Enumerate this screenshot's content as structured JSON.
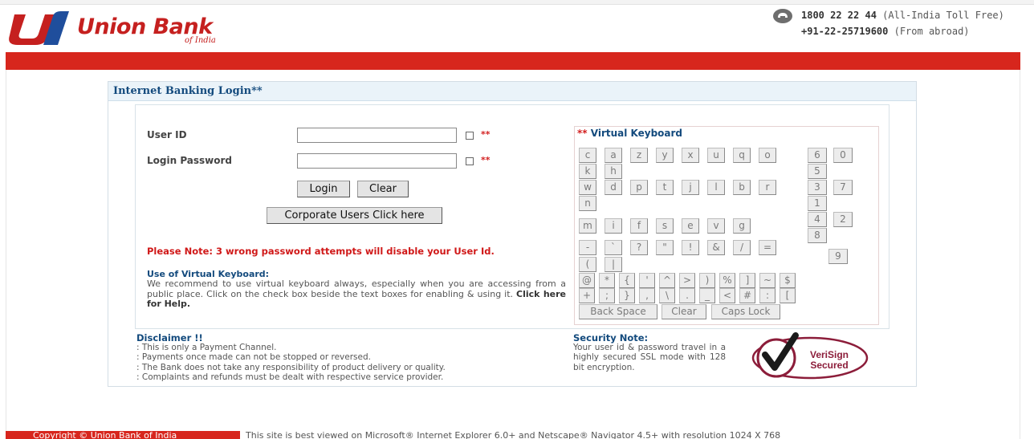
{
  "header": {
    "bank_name": "Union Bank",
    "bank_sub": "of India",
    "tollfree_number": "1800 22 22 44",
    "tollfree_note": "(All-India Toll Free)",
    "abroad_number": "+91-22-25719600",
    "abroad_note": "(From abroad)",
    "brand_color": "#d7261d",
    "phone_icon": "phone-icon"
  },
  "login": {
    "title": "Internet Banking Login**",
    "user_id_label": "User ID",
    "user_id_value": "",
    "password_label": "Login Password",
    "password_value": "",
    "required_mark": "**",
    "login_button": "Login",
    "clear_button": "Clear",
    "corporate_button": "Corporate Users Click here",
    "warning": "Please Note: 3 wrong password attempts will disable your User Id.",
    "vk_help_title": "Use of Virtual Keyboard:",
    "vk_help_text": "We recommend to use virtual keyboard always, especially when you are accessing from a public place. Click on the check box beside the text boxes for enabling & using it.",
    "vk_help_link": "Click here for Help."
  },
  "keyboard": {
    "title_mark": "**",
    "title": "Virtual Keyboard",
    "rows": [
      [
        "c",
        "a",
        "z",
        "y",
        "x",
        "u",
        "q",
        "o"
      ],
      [
        "k",
        "h"
      ],
      [
        "w",
        "d",
        "p",
        "t",
        "j",
        "l",
        "b",
        "r"
      ],
      [
        "n"
      ],
      [
        "m",
        "i",
        "f",
        "s",
        "e",
        "v",
        "g"
      ],
      [
        "-",
        "`",
        "?",
        "\"",
        "!",
        "&",
        "/",
        "="
      ],
      [
        "(",
        "|"
      ],
      [
        "@",
        "*",
        "{",
        "'",
        "^",
        ">",
        ")",
        "%",
        "]",
        "~",
        "$"
      ],
      [
        "+",
        ";",
        "}",
        ",",
        "\\",
        ".",
        "_",
        "<",
        "#",
        ":",
        "["
      ]
    ],
    "numbers": [
      "6",
      "0",
      "5",
      "3",
      "7",
      "1",
      "4",
      "2",
      "8",
      "9"
    ],
    "backspace": "Back Space",
    "clear": "Clear",
    "capslock": "Caps Lock"
  },
  "disclaimer": {
    "title": "Disclaimer !!",
    "lines": [
      ": This is only a Payment Channel.",
      ": Payments once made can not be stopped or reversed.",
      ": The Bank does not take any responsibility of product delivery or quality.",
      ": Complaints and refunds must be dealt with respective service provider."
    ]
  },
  "security": {
    "title": "Security Note:",
    "text": "Your user id & password travel in a highly secured SSL mode with 128 bit encryption.",
    "seal_line1": "VeriSign",
    "seal_line2": "Secured"
  },
  "footer": {
    "copyright": "Copyright © Union Bank of India",
    "best_viewed": "This site is best viewed on Microsoft® Internet Explorer 6.0+ and Netscape® Navigator 4.5+ with resolution 1024 X 768"
  }
}
